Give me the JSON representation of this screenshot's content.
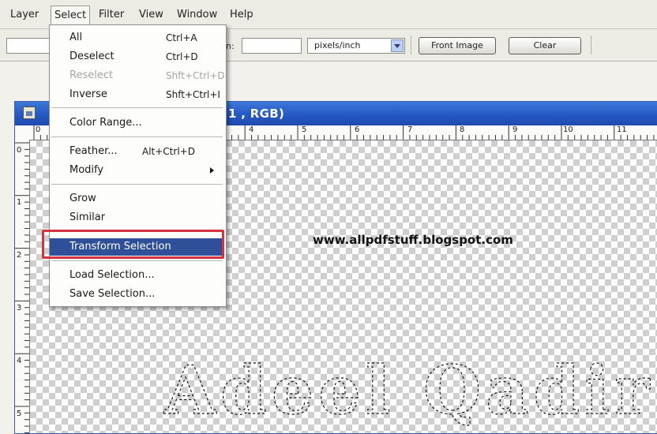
{
  "menubar": {
    "items": [
      "Layer",
      "Select",
      "Filter",
      "View",
      "Window",
      "Help"
    ],
    "active": "Select"
  },
  "options": {
    "field_label": "n:",
    "resolution_unit": "pixels/inch",
    "front_image_label": "Front Image",
    "clear_label": "Clear"
  },
  "document": {
    "title": "1 , RGB)",
    "ruler_top": [
      "0",
      "4",
      "5",
      "6",
      "7",
      "8",
      "9",
      "10",
      "11"
    ],
    "ruler_left": [
      "0",
      "1",
      "2",
      "3",
      "4",
      "5"
    ],
    "canvas_url": "www.allpdfstuff.blogspot.com",
    "canvas_selection_text": "Adeel Qadir"
  },
  "select_menu": {
    "items": [
      {
        "label": "All",
        "shortcut": "Ctrl+A"
      },
      {
        "label": "Deselect",
        "shortcut": "Ctrl+D"
      },
      {
        "label": "Reselect",
        "shortcut": "Shft+Ctrl+D",
        "disabled": true
      },
      {
        "label": "Inverse",
        "shortcut": "Shft+Ctrl+I"
      },
      {
        "label": "Color Range..."
      },
      {
        "label": "Feather...",
        "shortcut": "Alt+Ctrl+D"
      },
      {
        "label": "Modify",
        "submenu": true
      },
      {
        "label": "Grow"
      },
      {
        "label": "Similar"
      },
      {
        "label": "Transform Selection",
        "highlighted": true
      },
      {
        "label": "Load Selection..."
      },
      {
        "label": "Save Selection..."
      }
    ]
  },
  "colors": {
    "accent_highlight": "#2f4f98",
    "callout_border": "#d2333f",
    "titlebar": "#2558c4"
  }
}
